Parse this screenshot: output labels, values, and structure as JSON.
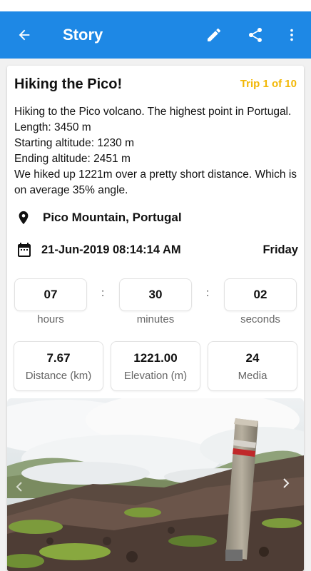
{
  "appbar": {
    "title": "Story",
    "color": "#1e88e5",
    "back_icon": "arrow-back-icon",
    "edit_icon": "pencil-icon",
    "share_icon": "share-icon",
    "more_icon": "more-vert-icon"
  },
  "story": {
    "title": "Hiking the Pico!",
    "trip_badge": "Trip 1 of 10",
    "description": "Hiking to the Pico volcano. The highest point in Portugal.\nLength: 3450 m\nStarting altitude: 1230 m\nEnding altitude: 2451 m\nWe hiked up 1221m over a pretty short distance. Which is on average 35% angle.",
    "location": "Pico Mountain, Portugal",
    "datetime": "21-Jun-2019 08:14:14 AM",
    "weekday": "Friday"
  },
  "duration": {
    "hours": "07",
    "minutes": "30",
    "seconds": "02",
    "hours_label": "hours",
    "minutes_label": "minutes",
    "seconds_label": "seconds",
    "separator": ":"
  },
  "stats": {
    "distance_value": "7.67",
    "distance_label": "Distance (km)",
    "elevation_value": "1221.00",
    "elevation_label": "Elevation (m)",
    "media_value": "24",
    "media_label": "Media"
  },
  "gallery": {
    "prev_icon": "chevron-left-icon",
    "next_icon": "chevron-right-icon"
  },
  "colors": {
    "accent": "#1e88e5",
    "badge": "#f2b705"
  }
}
